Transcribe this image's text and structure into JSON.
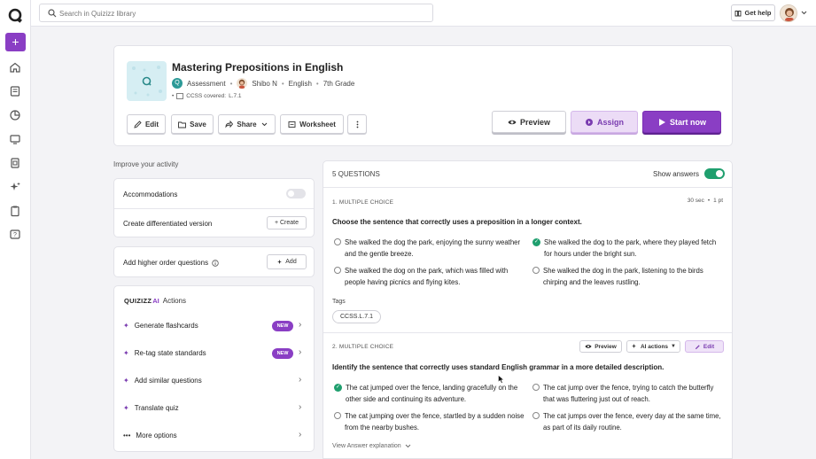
{
  "search": {
    "placeholder": "Search in Quizizz library"
  },
  "topbar": {
    "help_label": "Get help"
  },
  "sidebar": {
    "create_label": "+",
    "items": [
      "home-icon",
      "library-icon",
      "reports-icon",
      "classes-icon",
      "settings-icon",
      "ai-icon",
      "clipboard-icon",
      "help-icon"
    ]
  },
  "header": {
    "title": "Mastering Prepositions in English",
    "type": "Assessment",
    "author": "Shibo N",
    "subject": "English",
    "grade": "7th Grade",
    "ccss": "CCSS covered:",
    "ccss_code": "L.7.1",
    "buttons": {
      "edit": "Edit",
      "save": "Save",
      "share": "Share",
      "worksheet": "Worksheet",
      "preview": "Preview",
      "assign": "Assign",
      "start": "Start now"
    }
  },
  "improve": {
    "label": "Improve your activity",
    "accommodations": "Accommodations",
    "differentiated": "Create differentiated version",
    "create_btn": "+ Create",
    "higher_order": "Add higher order questions",
    "add_btn": "Add",
    "ai_brand": "QUIZIZZ",
    "ai_brand_suffix": "AI",
    "ai_actions_label": "Actions",
    "ai_items": [
      {
        "label": "Generate flashcards",
        "badge": "NEW"
      },
      {
        "label": "Re-tag state standards",
        "badge": "NEW"
      },
      {
        "label": "Add similar questions"
      },
      {
        "label": "Translate quiz"
      },
      {
        "label": "More options"
      }
    ]
  },
  "questions": {
    "count_label": "5 QUESTIONS",
    "show_answers": "Show answers",
    "items": [
      {
        "type": "1. MULTIPLE CHOICE",
        "time": "30 sec",
        "points": "1 pt",
        "text": "Choose the sentence that correctly uses a preposition in a longer context.",
        "options": [
          {
            "text": "She walked the dog the park, enjoying the sunny weather and the gentle breeze.",
            "correct": false
          },
          {
            "text": "She walked the dog to the park, where they played fetch for hours under the bright sun.",
            "correct": true
          },
          {
            "text": "She walked the dog on the park, which was filled with people having picnics and flying kites.",
            "correct": false
          },
          {
            "text": "She walked the dog in the park, listening to the birds chirping and the leaves rustling.",
            "correct": false
          }
        ],
        "tags_label": "Tags",
        "tag": "CCSS.L.7.1"
      },
      {
        "type": "2. MULTIPLE CHOICE",
        "preview_btn": "Preview",
        "ai_btn": "AI actions",
        "edit_btn": "Edit",
        "text": "Identify the sentence that correctly uses standard English grammar in a more detailed description.",
        "options": [
          {
            "text": "The cat jumped over the fence, landing gracefully on the other side and continuing its adventure.",
            "correct": true
          },
          {
            "text": "The cat jump over the fence, trying to catch the butterfly that was fluttering just out of reach.",
            "correct": false
          },
          {
            "text": "The cat jumping over the fence, startled by a sudden noise from the nearby bushes.",
            "correct": false
          },
          {
            "text": "The cat jumps over the fence, every day at the same time, as part of its daily routine.",
            "correct": false
          }
        ],
        "explanation": "View Answer explanation"
      }
    ]
  },
  "colors": {
    "brand": "#8a3ec4",
    "success": "#1f9f6e",
    "assign_bg": "#ecdcf6"
  }
}
